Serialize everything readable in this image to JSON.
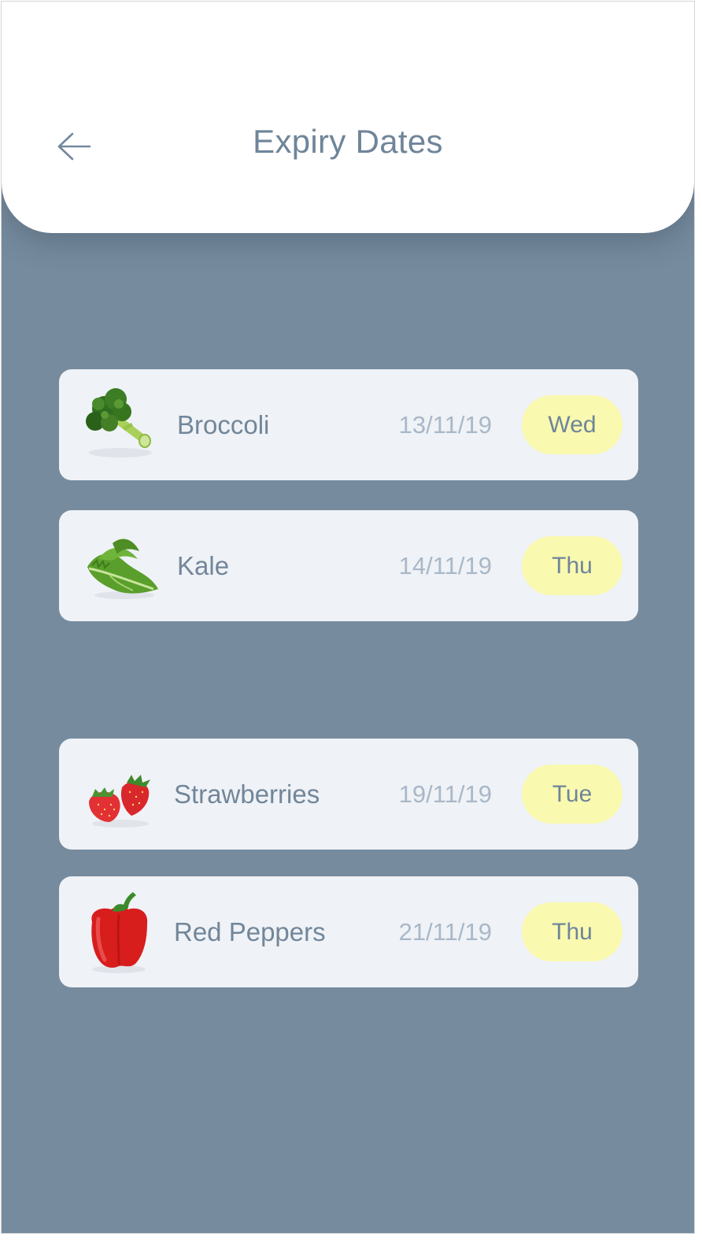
{
  "header": {
    "title": "Expiry Dates",
    "back_icon": "arrow-left-icon"
  },
  "colors": {
    "background": "#768b9e",
    "card": "#eff2f6",
    "pill": "#f9f9b0",
    "title_text": "#6f8599",
    "date_text": "#a9b8c8"
  },
  "items": [
    {
      "name": "Broccoli",
      "date": "13/11/19",
      "day": "Wed",
      "icon": "broccoli-icon"
    },
    {
      "name": "Kale",
      "date": "14/11/19",
      "day": "Thu",
      "icon": "kale-icon"
    },
    {
      "name": "Strawberries",
      "date": "19/11/19",
      "day": "Tue",
      "icon": "strawberries-icon"
    },
    {
      "name": "Red Peppers",
      "date": "21/11/19",
      "day": "Thu",
      "icon": "red-pepper-icon"
    }
  ]
}
